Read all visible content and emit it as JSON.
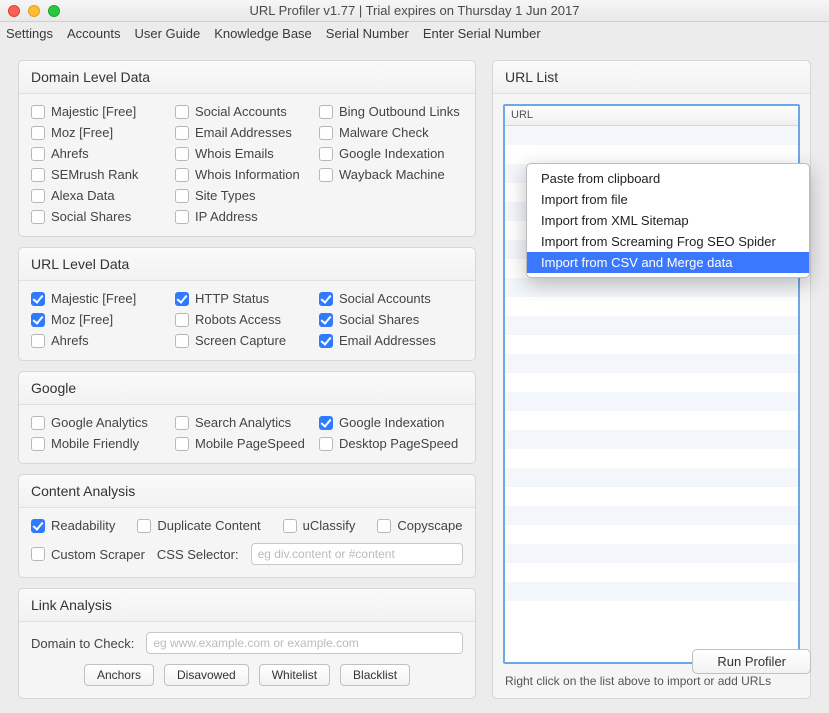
{
  "window": {
    "title": "URL Profiler v1.77 | Trial expires on Thursday 1 Jun 2017"
  },
  "menubar": [
    "Settings",
    "Accounts",
    "User Guide",
    "Knowledge Base",
    "Serial Number",
    "Enter Serial Number"
  ],
  "panels": {
    "domain": {
      "title": "Domain Level Data",
      "cols": [
        [
          {
            "label": "Majestic [Free]",
            "checked": false
          },
          {
            "label": "Moz [Free]",
            "checked": false
          },
          {
            "label": "Ahrefs",
            "checked": false
          },
          {
            "label": "SEMrush Rank",
            "checked": false
          },
          {
            "label": "Alexa Data",
            "checked": false
          },
          {
            "label": "Social Shares",
            "checked": false
          }
        ],
        [
          {
            "label": "Social Accounts",
            "checked": false
          },
          {
            "label": "Email Addresses",
            "checked": false
          },
          {
            "label": "Whois Emails",
            "checked": false
          },
          {
            "label": "Whois Information",
            "checked": false
          },
          {
            "label": "Site Types",
            "checked": false
          },
          {
            "label": "IP Address",
            "checked": false
          }
        ],
        [
          {
            "label": "Bing Outbound Links",
            "checked": false
          },
          {
            "label": "Malware Check",
            "checked": false
          },
          {
            "label": "Google Indexation",
            "checked": false
          },
          {
            "label": "Wayback Machine",
            "checked": false
          }
        ]
      ]
    },
    "url": {
      "title": "URL Level Data",
      "cols": [
        [
          {
            "label": "Majestic [Free]",
            "checked": true
          },
          {
            "label": "Moz [Free]",
            "checked": true
          },
          {
            "label": "Ahrefs",
            "checked": false
          }
        ],
        [
          {
            "label": "HTTP Status",
            "checked": true
          },
          {
            "label": "Robots Access",
            "checked": false
          },
          {
            "label": "Screen Capture",
            "checked": false
          }
        ],
        [
          {
            "label": "Social Accounts",
            "checked": true
          },
          {
            "label": "Social Shares",
            "checked": true
          },
          {
            "label": "Email Addresses",
            "checked": true
          }
        ]
      ]
    },
    "google": {
      "title": "Google",
      "cols": [
        [
          {
            "label": "Google Analytics",
            "checked": false
          },
          {
            "label": "Mobile Friendly",
            "checked": false
          }
        ],
        [
          {
            "label": "Search Analytics",
            "checked": false
          },
          {
            "label": "Mobile PageSpeed",
            "checked": false
          }
        ],
        [
          {
            "label": "Google Indexation",
            "checked": true
          },
          {
            "label": "Desktop PageSpeed",
            "checked": false
          }
        ]
      ]
    },
    "content": {
      "title": "Content Analysis",
      "row1": [
        {
          "label": "Readability",
          "checked": true
        },
        {
          "label": "Duplicate Content",
          "checked": false
        },
        {
          "label": "uClassify",
          "checked": false
        },
        {
          "label": "Copyscape",
          "checked": false
        }
      ],
      "custom_scraper": {
        "label": "Custom Scraper",
        "checked": false
      },
      "css_selector_label": "CSS Selector:",
      "css_selector_placeholder": "eg div.content or #content"
    },
    "link": {
      "title": "Link Analysis",
      "domain_label": "Domain to Check:",
      "domain_placeholder": "eg www.example.com or example.com",
      "buttons": [
        "Anchors",
        "Disavowed",
        "Whitelist",
        "Blacklist"
      ]
    }
  },
  "urllist": {
    "title": "URL List",
    "column": "URL",
    "hint": "Right click on the list above to import or add URLs"
  },
  "context_menu": {
    "items": [
      "Paste from clipboard",
      "Import from file",
      "Import from XML Sitemap",
      "Import from Screaming Frog SEO Spider",
      "Import from CSV and Merge data"
    ],
    "selected_index": 4
  },
  "run_button": "Run Profiler"
}
